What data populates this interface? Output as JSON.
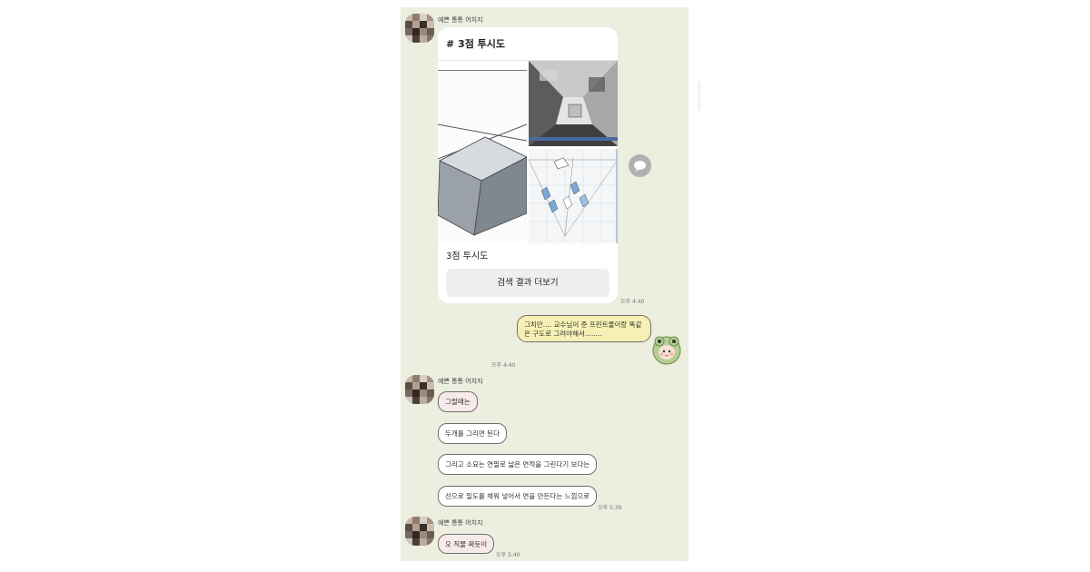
{
  "contact": {
    "name": "예쁜 통통 어치지"
  },
  "card": {
    "title": "# 3점 투시도",
    "caption": "3점 투시도",
    "button_label": "검색 결과 더보기"
  },
  "times": {
    "card": "오후 4:40",
    "mine": "오후 4:40",
    "group2": "오후 5:39",
    "group3": "오후 5:40"
  },
  "my_message": "그치만.... 교수님이 준 프린트물이랑 똑같은 구도로 그려야해서........",
  "group2_messages": [
    "그럴때는",
    "두개를 그리면 된다",
    "그리고 소묘는 연필로 넓은 면적을 그린다기 보다는",
    "선으로 밀도를 채워 넣어서 면을 만든다는 느낌으로"
  ],
  "group3_messages": [
    "오 직물 짜듯이"
  ],
  "icons": {
    "share": "share-bubble-icon",
    "avatar": "pixelated-avatar",
    "sticker": "frog-hood-sticker"
  },
  "colors": {
    "chat_bg": "#eceedf",
    "my_bubble": "#f6f0b4",
    "pink_bubble": "#f8e9ea"
  }
}
